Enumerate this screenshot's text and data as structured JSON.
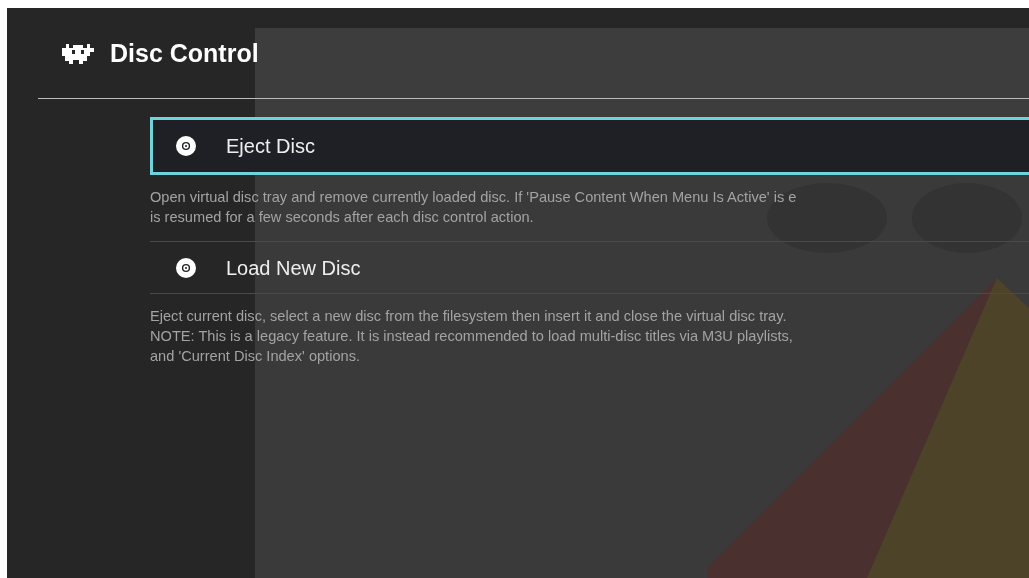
{
  "header": {
    "title": "Disc Control"
  },
  "items": [
    {
      "label": "Eject Disc",
      "selected": true,
      "description": [
        "Open virtual disc tray and remove currently loaded disc. If 'Pause Content When Menu Is Active' is e",
        "is resumed for a few seconds after each disc control action."
      ]
    },
    {
      "label": "Load New Disc",
      "selected": false,
      "description": [
        "Eject current disc, select a new disc from the filesystem then insert it and close the virtual disc tray.",
        "NOTE: This is a legacy feature. It is instead recommended to load multi-disc titles via M3U playlists,",
        "and 'Current Disc Index' options."
      ]
    }
  ]
}
